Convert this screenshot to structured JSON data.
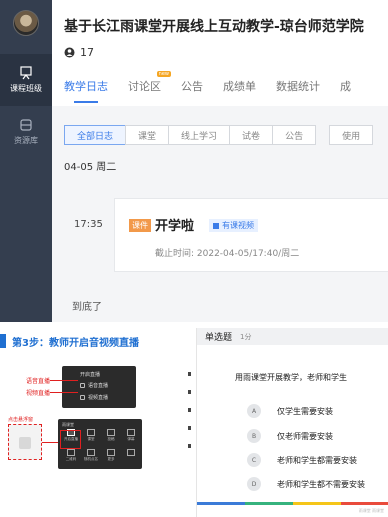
{
  "sidebar": {
    "items": [
      {
        "label": "课程班级",
        "icon": "class-icon",
        "active": true
      },
      {
        "label": "资源库",
        "icon": "library-icon",
        "active": false
      }
    ]
  },
  "course": {
    "title": "基于长江雨课堂开展线上互动教学-琼台师范学院",
    "member_count": "17"
  },
  "tabs": [
    {
      "label": "教学日志",
      "active": true
    },
    {
      "label": "讨论区",
      "badge": "new"
    },
    {
      "label": "公告"
    },
    {
      "label": "成绩单"
    },
    {
      "label": "数据统计"
    },
    {
      "label": "成"
    }
  ],
  "filters": [
    "全部日志",
    "课堂",
    "线上学习",
    "试卷",
    "公告",
    "使用"
  ],
  "log": {
    "date": "04-05 周二",
    "time": "17:35",
    "badge": "课件",
    "title": "开学啦",
    "tag": "有课视频",
    "deadline": "截止时间: 2022-04-05/17:40/周二",
    "end_text": "到底了"
  },
  "slide": {
    "step_title": "第3步：教师开启音视频直播",
    "menu_title": "开启直播",
    "menu_items": [
      "语音直播",
      "视频直播"
    ],
    "callouts": [
      "语音直播",
      "视频直播",
      "点击悬浮窗"
    ],
    "panel_head": "雨课堂",
    "panel_items": [
      "开启直播",
      "课堂",
      "投稿",
      "弹幕",
      "二维码",
      "随机点名",
      "更多",
      ""
    ]
  },
  "quiz": {
    "type": "单选题",
    "score": "1分",
    "question": "用雨课堂开展教学，老师和学生",
    "options": [
      {
        "letter": "A",
        "text": "仅学生需要安装"
      },
      {
        "letter": "B",
        "text": "仅老师需要安装"
      },
      {
        "letter": "C",
        "text": "老师和学生都需要安装"
      },
      {
        "letter": "D",
        "text": "老师和学生都不需要安装"
      }
    ],
    "footer": "雨课堂 雨课堂",
    "progress_colors": [
      "#3b7bd8",
      "#36b37e",
      "#f5c518",
      "#e94b3c"
    ]
  },
  "colors": {
    "accent": "#3a7be8",
    "sidebar": "#343e4f",
    "step_blue": "#1f6fd1",
    "callout_red": "#e02020"
  }
}
